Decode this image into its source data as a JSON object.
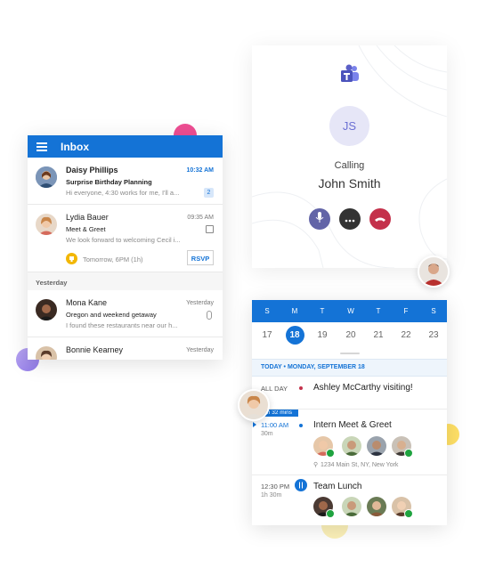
{
  "inbox": {
    "title": "Inbox",
    "messages": [
      {
        "sender": "Daisy Phillips",
        "time": "10:32 AM",
        "subject": "Surprise Birthday Planning",
        "preview": "Hi everyone, 4:30 works for me, I'll a...",
        "badge": "2"
      },
      {
        "sender": "Lydia Bauer",
        "time": "09:35 AM",
        "subject": "Meet & Greet",
        "preview": "We look forward to welcoming Cecil i...",
        "event_time": "Tomorrow, 6PM (1h)",
        "rsvp": "RSVP"
      },
      {
        "sender": "Mona Kane",
        "time": "Yesterday",
        "subject": "Oregon and weekend getaway",
        "preview": "I found these restaurants near our h..."
      },
      {
        "sender": "Bonnie Kearney",
        "time": "Yesterday"
      }
    ],
    "section_yesterday": "Yesterday"
  },
  "call": {
    "initials": "JS",
    "status": "Calling",
    "name": "John Smith"
  },
  "calendar": {
    "weekdays": [
      "S",
      "M",
      "T",
      "W",
      "T",
      "F",
      "S"
    ],
    "days": [
      "17",
      "18",
      "19",
      "20",
      "21",
      "22",
      "23"
    ],
    "selected_day": "18",
    "header": "TODAY • MONDAY, SEPTEMBER 18",
    "events": [
      {
        "time": "ALL DAY",
        "title": "Ashley McCarthy visiting!"
      },
      {
        "badge": "In 32 mins",
        "time": "11:00 AM",
        "duration": "30m",
        "title": "Intern Meet & Greet",
        "location": "1234 Main St, NY, New York"
      },
      {
        "time": "12:30 PM",
        "duration": "1h 30m",
        "title": "Team Lunch"
      }
    ]
  },
  "colors": {
    "accent": "#1473d6",
    "teams": "#5b5fc7",
    "hangup": "#c4314b",
    "accept": "#1fa33f"
  }
}
